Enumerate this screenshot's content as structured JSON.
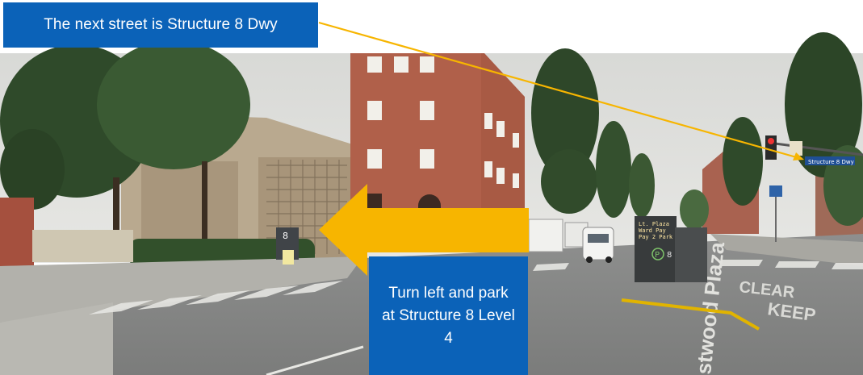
{
  "callouts": {
    "next_street": "The next street is Structure 8 Dwy",
    "instruction": "Turn left and park at Structure 8 Level 4"
  },
  "scene": {
    "structure_sign": "8",
    "street_sign": "Structure 8 Dwy",
    "road_marking_clear": "CLEAR",
    "road_marking_keep": "KEEP",
    "street_name_painted": "stwood Plaza",
    "kiosk_sign_lines": [
      "Lt. Plaza",
      "Ward Pay",
      "Pay 2 Park"
    ],
    "kiosk_logo": "P",
    "kiosk_number": "8"
  },
  "colors": {
    "callout_bg": "#0b62b8",
    "arrow_left": "#f7b500",
    "pointer_line": "#f7b500"
  }
}
